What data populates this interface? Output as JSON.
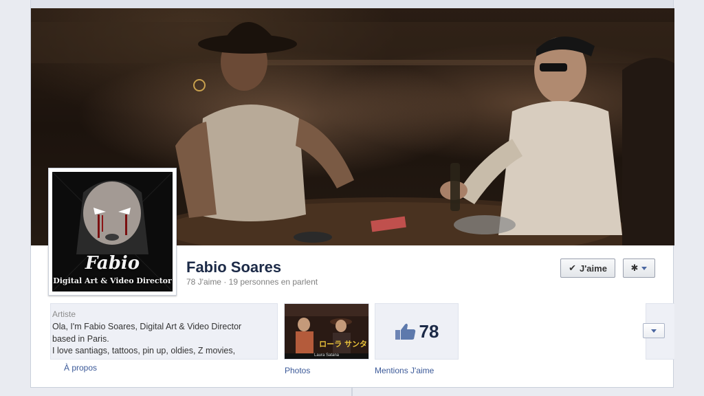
{
  "page": {
    "name": "Fabio Soares",
    "stats": "78 J'aime · 19 personnes en parlent"
  },
  "profile_picture": {
    "line1": "Fabio",
    "line2": "Digital Art & Video Director"
  },
  "actions": {
    "like_label": "J'aime",
    "settings_icon": "gear-icon"
  },
  "about": {
    "category": "Artiste",
    "text_lines": [
      "Ola, I'm Fabio Soares, Digital Art & Video Director",
      "based in Paris.",
      "I love santiags, tattoos, pin up, oldies, Z movies,"
    ],
    "tab_label": "À propos"
  },
  "photos": {
    "tab_label": "Photos",
    "thumbnail_text": "ローラ サンタ",
    "thumbnail_caption": "Laura Satana"
  },
  "likes": {
    "count": "78",
    "tab_label": "Mentions J'aime",
    "icon": "thumbs-up-icon"
  },
  "more": {
    "icon": "chevron-down-icon"
  },
  "colors": {
    "link": "#3b5998",
    "title": "#1c2a47",
    "panel_bg": "#eef0f6"
  }
}
